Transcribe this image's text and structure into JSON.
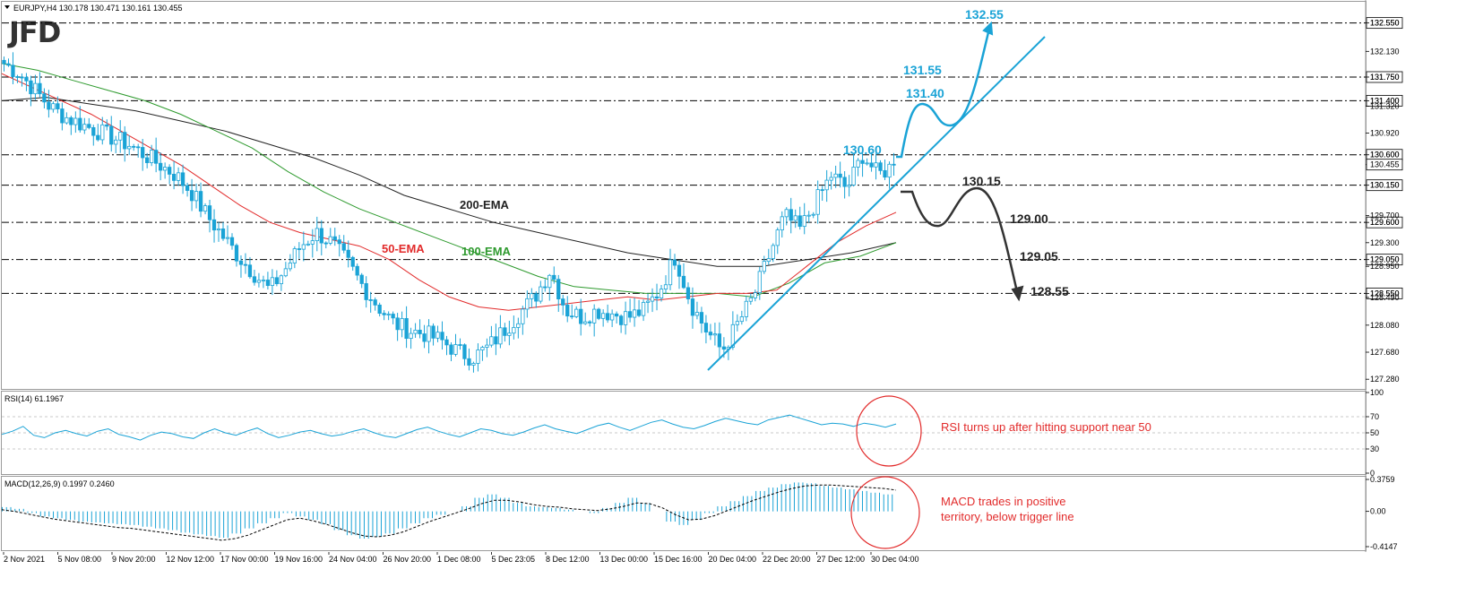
{
  "header": {
    "main_title": "EURJPY,H4  130.178 130.471 130.161 130.455",
    "rsi_title": "RSI(14) 61.1967",
    "macd_title": "MACD(12,26,9) 0.1997 0.2460"
  },
  "logo": {
    "text": "JFD"
  },
  "colors": {
    "blue": "#1aa3d6",
    "red": "#e22b2b",
    "green": "#2e9a2e",
    "black": "#222222",
    "candle": "#1aa3d6"
  },
  "chart_data": [
    {
      "type": "line",
      "title": "EURJPY,H4",
      "x_ticks": [
        "2 Nov 2021",
        "5 Nov 08:00",
        "9 Nov 20:00",
        "12 Nov 12:00",
        "17 Nov 00:00",
        "19 Nov 16:00",
        "24 Nov 04:00",
        "26 Nov 20:00",
        "1 Dec 08:00",
        "5 Dec 23:05",
        "8 Dec 12:00",
        "13 Dec 00:00",
        "15 Dec 16:00",
        "20 Dec 04:00",
        "22 Dec 20:00",
        "27 Dec 12:00",
        "30 Dec 04:00"
      ],
      "y_ticks": [
        "132.550",
        "132.130",
        "131.750",
        "131.400",
        "131.320",
        "130.920",
        "130.600",
        "130.455",
        "130.150",
        "129.700",
        "129.600",
        "129.300",
        "129.050",
        "128.950",
        "128.550",
        "128.490",
        "128.080",
        "127.680",
        "127.280"
      ],
      "ylim": [
        127.15,
        132.85
      ],
      "levels": [
        {
          "value": 132.55,
          "label": "132.550"
        },
        {
          "value": 131.75,
          "label": "131.750"
        },
        {
          "value": 131.4,
          "label": "131.400"
        },
        {
          "value": 130.6,
          "label": "130.600"
        },
        {
          "value": 130.15,
          "label": "130.150"
        },
        {
          "value": 129.6,
          "label": "129.600"
        },
        {
          "value": 129.05,
          "label": "129.050"
        },
        {
          "value": 128.55,
          "label": "128.550"
        }
      ],
      "current_price": {
        "value": 130.455,
        "label": "130.455"
      },
      "closes": [
        131.95,
        131.8,
        131.55,
        131.3,
        131.15,
        131.05,
        130.95,
        130.85,
        130.75,
        130.6,
        130.45,
        130.3,
        130.05,
        129.7,
        129.4,
        129.1,
        128.85,
        128.6,
        128.9,
        129.25,
        129.45,
        129.3,
        129.0,
        128.65,
        128.35,
        128.1,
        128.0,
        127.95,
        127.85,
        127.7,
        127.6,
        127.75,
        128.0,
        128.25,
        128.5,
        128.9,
        128.3,
        128.2,
        128.3,
        128.25,
        128.2,
        128.3,
        128.6,
        129.1,
        128.4,
        128.0,
        127.7,
        128.1,
        128.5,
        129.1,
        129.7,
        129.5,
        129.9,
        130.3,
        130.1,
        130.6,
        130.3,
        130.455
      ],
      "ema_50": [
        131.8,
        131.6,
        131.4,
        131.2,
        130.95,
        130.7,
        130.45,
        130.15,
        129.85,
        129.6,
        129.45,
        129.35,
        129.25,
        129.05,
        128.75,
        128.5,
        128.35,
        128.3,
        128.35,
        128.4,
        128.45,
        128.5,
        128.45,
        128.5,
        128.55,
        128.55,
        128.6,
        128.95,
        129.3,
        129.55,
        129.75
      ],
      "ema_100": [
        131.95,
        131.85,
        131.7,
        131.55,
        131.4,
        131.2,
        130.95,
        130.7,
        130.35,
        130.05,
        129.8,
        129.6,
        129.4,
        129.2,
        129.0,
        128.8,
        128.65,
        128.6,
        128.55,
        128.55,
        128.55,
        128.5,
        128.7,
        129.0,
        129.1,
        129.3
      ],
      "ema_200": [
        131.4,
        131.45,
        131.35,
        131.25,
        131.1,
        130.95,
        130.75,
        130.55,
        130.3,
        130.0,
        129.8,
        129.6,
        129.45,
        129.3,
        129.15,
        129.05,
        128.95,
        128.95,
        129.05,
        129.15,
        129.3
      ],
      "series_labels": {
        "ema_200": "200-EMA",
        "ema_50": "50-EMA",
        "ema_100": "100-EMA"
      },
      "annotations": {
        "bull_target_1": "130.60",
        "bull_target_2": "131.40",
        "bull_target_3": "131.55",
        "bull_target_4": "132.55",
        "bear_target_1": "130.15",
        "bear_target_2": "129.00",
        "bear_target_3": "129.05",
        "bear_target_4": "128.55"
      }
    },
    {
      "type": "line",
      "title": "RSI(14) 61.1967",
      "y_ticks": [
        "100",
        "70",
        "50",
        "30",
        "0"
      ],
      "ylim": [
        0,
        100
      ],
      "levels": [
        70,
        50,
        30
      ],
      "values": [
        48,
        52,
        58,
        47,
        44,
        50,
        53,
        49,
        46,
        52,
        55,
        48,
        45,
        41,
        47,
        51,
        49,
        45,
        43,
        50,
        55,
        50,
        47,
        52,
        56,
        49,
        44,
        47,
        51,
        53,
        49,
        46,
        48,
        52,
        55,
        50,
        46,
        44,
        49,
        54,
        57,
        52,
        48,
        45,
        50,
        55,
        53,
        49,
        47,
        51,
        56,
        60,
        55,
        52,
        49,
        54,
        59,
        62,
        57,
        53,
        58,
        63,
        66,
        61,
        57,
        55,
        59,
        64,
        68,
        65,
        62,
        60,
        66,
        69,
        72,
        68,
        64,
        60,
        62,
        61,
        58,
        62,
        60,
        57,
        61
      ],
      "note": "RSI turns up after hitting support near 50"
    },
    {
      "type": "bar",
      "title": "MACD(12,26,9) 0.1997 0.2460",
      "y_ticks": [
        "0.3759",
        "0.00",
        "-0.4147"
      ],
      "ylim": [
        -0.4147,
        0.3759
      ],
      "histogram": [
        0.05,
        0.03,
        -0.02,
        -0.06,
        -0.08,
        -0.1,
        -0.12,
        -0.13,
        -0.14,
        -0.15,
        -0.16,
        -0.18,
        -0.2,
        -0.22,
        -0.25,
        -0.27,
        -0.29,
        -0.31,
        -0.26,
        -0.2,
        -0.14,
        -0.08,
        -0.02,
        -0.06,
        -0.1,
        -0.15,
        -0.22,
        -0.28,
        -0.32,
        -0.3,
        -0.26,
        -0.2,
        -0.14,
        -0.08,
        -0.04,
        0.0,
        0.06,
        0.16,
        0.2,
        0.16,
        0.1,
        0.06,
        0.05,
        0.04,
        0.02,
        0.0,
        -0.02,
        0.04,
        0.1,
        0.16,
        0.1,
        0.0,
        -0.12,
        -0.16,
        -0.1,
        -0.02,
        0.06,
        0.12,
        0.18,
        0.24,
        0.28,
        0.32,
        0.34,
        0.33,
        0.3,
        0.28,
        0.26,
        0.24,
        0.22,
        0.2
      ],
      "signal": [
        0.02,
        0.0,
        -0.03,
        -0.06,
        -0.09,
        -0.11,
        -0.13,
        -0.15,
        -0.17,
        -0.19,
        -0.2,
        -0.22,
        -0.24,
        -0.26,
        -0.28,
        -0.3,
        -0.32,
        -0.34,
        -0.32,
        -0.28,
        -0.22,
        -0.16,
        -0.1,
        -0.08,
        -0.11,
        -0.15,
        -0.2,
        -0.25,
        -0.29,
        -0.3,
        -0.28,
        -0.24,
        -0.18,
        -0.12,
        -0.07,
        -0.02,
        0.03,
        0.09,
        0.13,
        0.13,
        0.11,
        0.08,
        0.06,
        0.05,
        0.03,
        0.02,
        0.01,
        0.03,
        0.06,
        0.1,
        0.09,
        0.04,
        -0.04,
        -0.1,
        -0.09,
        -0.05,
        0.01,
        0.07,
        0.13,
        0.18,
        0.23,
        0.27,
        0.3,
        0.31,
        0.31,
        0.3,
        0.29,
        0.28,
        0.27,
        0.25
      ],
      "note": "MACD trades in positive territory, below trigger line"
    }
  ]
}
